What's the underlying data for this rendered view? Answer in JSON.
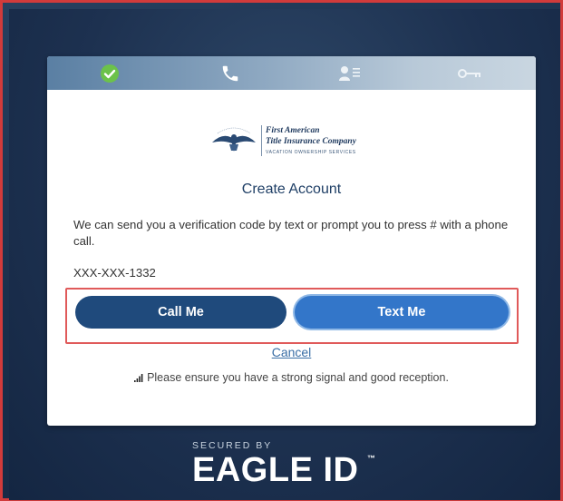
{
  "steps": [
    {
      "name": "verified",
      "icon": "check-circle-icon",
      "state": "complete"
    },
    {
      "name": "phone",
      "icon": "phone-icon",
      "state": "current"
    },
    {
      "name": "profile",
      "icon": "id-card-icon",
      "state": "pending"
    },
    {
      "name": "password",
      "icon": "key-icon",
      "state": "pending"
    }
  ],
  "logo": {
    "line1": "First American",
    "line2": "Title Insurance Company",
    "line3": "VACATION OWNERSHIP SERVICES",
    "seal_text": "FIRST AMERICA"
  },
  "title": "Create Account",
  "description": "We can send you a verification code by text or prompt you to press # with a phone call.",
  "phone_number": "XXX-XXX-1332",
  "buttons": {
    "call_label": "Call Me",
    "text_label": "Text Me"
  },
  "cancel_label": "Cancel",
  "notice": "Please ensure you have a strong signal and good reception.",
  "footer": {
    "secured_by": "SECURED BY",
    "brand": "EAGLE ID",
    "trademark": "™"
  },
  "colors": {
    "accent_dark": "#1f4a7c",
    "accent_light": "#3376c9",
    "highlight": "#e05a5a",
    "check_green": "#6cc24a"
  }
}
